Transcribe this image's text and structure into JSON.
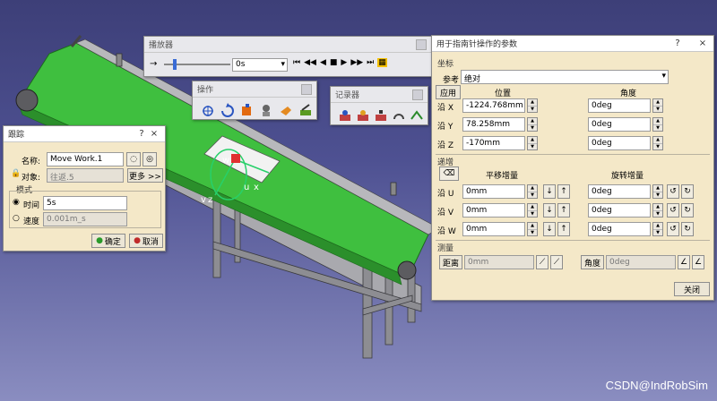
{
  "player": {
    "title": "播放器",
    "time_value": "0s",
    "controls": [
      "skip-to-start",
      "step-back",
      "play-backward",
      "stop",
      "play-forward",
      "step-forward",
      "skip-to-end",
      "settings"
    ]
  },
  "ops_toolbar": {
    "title": "操作"
  },
  "recorder": {
    "title": "记录器"
  },
  "track_dialog": {
    "title": "跟踪",
    "help": "?",
    "close": "×",
    "name_label": "名称:",
    "name_value": "Move Work.1",
    "object_label": "对象:",
    "object_value": "往返.5",
    "more_button": "更多 >>",
    "mode_section": "模式",
    "time_label": "时间",
    "time_value": "5s",
    "speed_label": "速度",
    "speed_value": "0.001m_s",
    "ok_button": "确定",
    "cancel_button": "取消",
    "selected_mode": "时间"
  },
  "compass_dialog": {
    "title": "用于指南针操作的参数",
    "help": "?",
    "close": "×",
    "coords_section": "坐标",
    "reference_label": "参考",
    "reference_value": "绝对",
    "apply_button": "应用",
    "position_header": "位置",
    "angle_header": "角度",
    "axis_x": "沿 X",
    "axis_y": "沿 Y",
    "axis_z": "沿 Z",
    "pos_x": "-1224.768mm",
    "pos_y": "78.258mm",
    "pos_z": "-170mm",
    "ang_x": "0deg",
    "ang_y": "0deg",
    "ang_z": "0deg",
    "increment_section": "递增",
    "translate_inc_header": "平移增量",
    "rotate_inc_header": "旋转增量",
    "axis_u": "沿 U",
    "axis_v": "沿 V",
    "axis_w": "沿 W",
    "tr_u": "0mm",
    "tr_v": "0mm",
    "tr_w": "0mm",
    "rot_u": "0deg",
    "rot_v": "0deg",
    "rot_w": "0deg",
    "measure_section": "测量",
    "distance_button": "距离",
    "distance_value": "0mm",
    "angle_button": "角度",
    "angle_value": "0deg",
    "close_button": "关闭"
  },
  "viewport": {
    "axis_labels": [
      "w",
      "z",
      "u",
      "x",
      "v"
    ],
    "accent_green": "#3fbf3f"
  },
  "watermark": "CSDN@IndRobSim"
}
